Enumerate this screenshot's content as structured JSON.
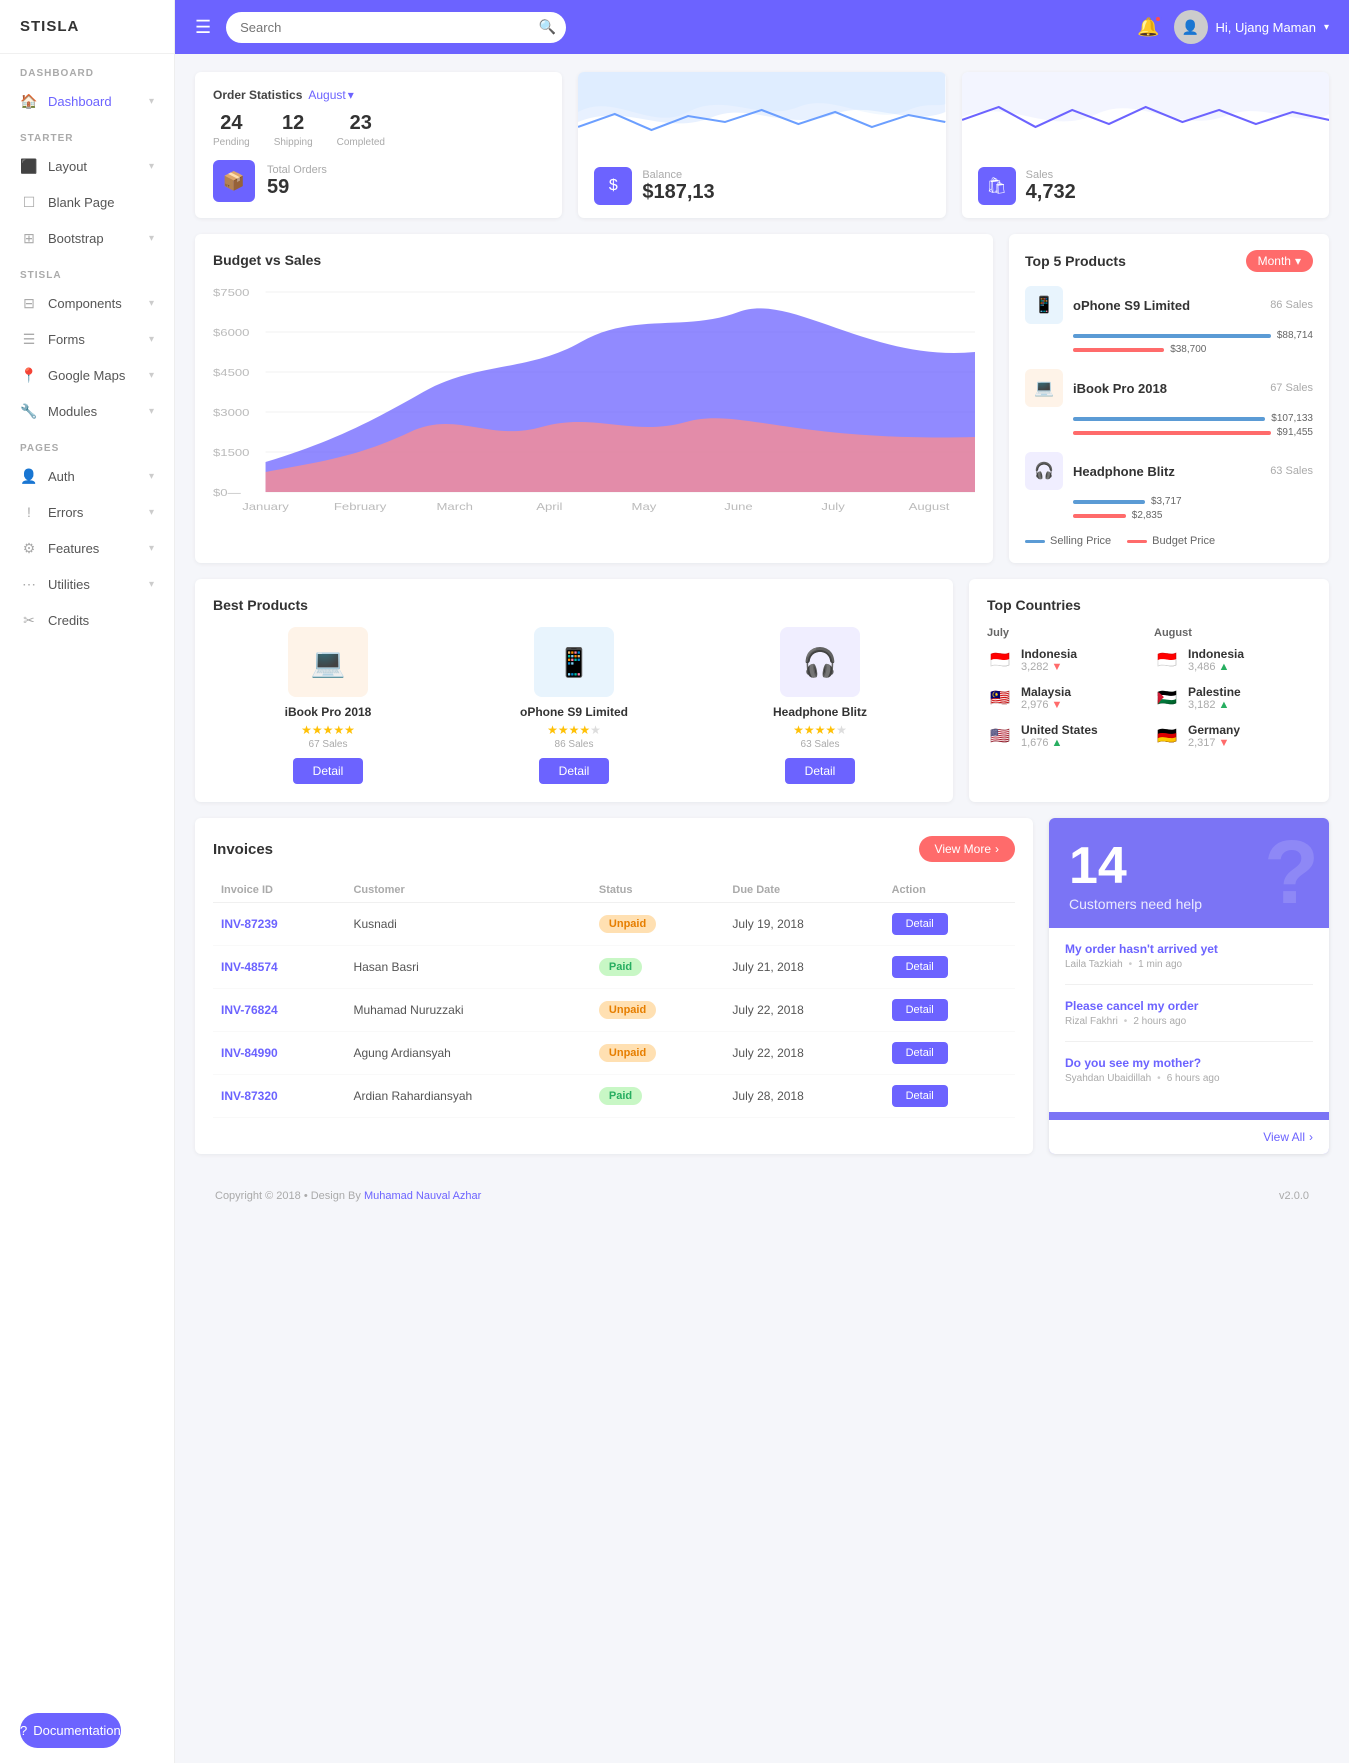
{
  "app": {
    "title": "STISLA"
  },
  "sidebar": {
    "sections": [
      {
        "label": "DASHBOARD",
        "items": [
          {
            "id": "dashboard",
            "label": "Dashboard",
            "icon": "🏠",
            "arrow": true
          }
        ]
      },
      {
        "label": "STARTER",
        "items": [
          {
            "id": "layout",
            "label": "Layout",
            "icon": "⬛",
            "arrow": true
          },
          {
            "id": "blank",
            "label": "Blank Page",
            "icon": "☐",
            "arrow": false
          },
          {
            "id": "bootstrap",
            "label": "Bootstrap",
            "icon": "⊞",
            "arrow": true
          }
        ]
      },
      {
        "label": "STISLA",
        "items": [
          {
            "id": "components",
            "label": "Components",
            "icon": "⊟",
            "arrow": true
          },
          {
            "id": "forms",
            "label": "Forms",
            "icon": "☰",
            "arrow": true
          },
          {
            "id": "googlemaps",
            "label": "Google Maps",
            "icon": "📍",
            "arrow": true
          },
          {
            "id": "modules",
            "label": "Modules",
            "icon": "🔧",
            "arrow": true
          }
        ]
      },
      {
        "label": "PAGES",
        "items": [
          {
            "id": "auth",
            "label": "Auth",
            "icon": "👤",
            "arrow": true
          },
          {
            "id": "errors",
            "label": "Errors",
            "icon": "!",
            "arrow": true
          },
          {
            "id": "features",
            "label": "Features",
            "icon": "⚙",
            "arrow": true
          },
          {
            "id": "utilities",
            "label": "Utilities",
            "icon": "⋯",
            "arrow": true
          },
          {
            "id": "credits",
            "label": "Credits",
            "icon": "✂",
            "arrow": false
          }
        ]
      }
    ],
    "doc_btn": "Documentation"
  },
  "topbar": {
    "search_placeholder": "Search",
    "username": "Hi, Ujang Maman"
  },
  "order_stats": {
    "title": "Order Statistics",
    "month": "August",
    "pending_label": "Pending",
    "pending_val": "24",
    "shipping_label": "Shipping",
    "shipping_val": "12",
    "completed_label": "Completed",
    "completed_val": "23",
    "total_orders_label": "Total Orders",
    "total_orders_val": "59"
  },
  "balance": {
    "label": "Balance",
    "value": "$187,13"
  },
  "sales": {
    "label": "Sales",
    "value": "4,732"
  },
  "budget_chart": {
    "title": "Budget vs Sales",
    "months": [
      "January",
      "February",
      "March",
      "April",
      "May",
      "June",
      "July",
      "August"
    ],
    "y_labels": [
      "$7500",
      "$6000",
      "$4500",
      "$3000",
      "$1500",
      "$0-"
    ]
  },
  "top_products": {
    "title": "Top 5 Products",
    "month_btn": "Month",
    "legend_selling": "Selling Price",
    "legend_budget": "Budget Price",
    "items": [
      {
        "name": "oPhone S9 Limited",
        "icon_type": "blue-light",
        "icon": "📱",
        "sales": "86 Sales",
        "selling_val": "$88,714",
        "selling_pct": 85,
        "budget_val": "$38,700",
        "budget_pct": 38
      },
      {
        "name": "iBook Pro 2018",
        "icon_type": "orange-light",
        "icon": "💻",
        "sales": "67 Sales",
        "selling_val": "$107,133",
        "selling_pct": 100,
        "budget_val": "$91,455",
        "budget_pct": 86
      },
      {
        "name": "Headphone Blitz",
        "icon_type": "purple-light",
        "icon": "🎧",
        "sales": "63 Sales",
        "selling_val": "$3,717",
        "selling_pct": 30,
        "budget_val": "$2,835",
        "budget_pct": 22
      }
    ]
  },
  "best_products": {
    "title": "Best Products",
    "items": [
      {
        "name": "iBook Pro 2018",
        "icon": "💻",
        "icon_type": "orange",
        "stars": 5,
        "sales": "67 Sales"
      },
      {
        "name": "oPhone S9 Limited",
        "icon": "📱",
        "icon_type": "blue",
        "stars": 4,
        "sales": "86 Sales"
      },
      {
        "name": "Headphone Blitz",
        "icon": "🎧",
        "icon_type": "purple",
        "stars": 4,
        "sales": "63 Sales"
      }
    ],
    "detail_btn": "Detail"
  },
  "top_countries": {
    "title": "Top Countries",
    "july_label": "July",
    "august_label": "August",
    "july_items": [
      {
        "country": "Indonesia",
        "flag": "🇮🇩",
        "count": "3,282",
        "trend": "down"
      },
      {
        "country": "Malaysia",
        "flag": "🇲🇾",
        "count": "2,976",
        "trend": "down"
      },
      {
        "country": "United States",
        "flag": "🇺🇸",
        "count": "1,676",
        "trend": "up"
      }
    ],
    "august_items": [
      {
        "country": "Indonesia",
        "flag": "🇮🇩",
        "count": "3,486",
        "trend": "up"
      },
      {
        "country": "Palestine",
        "flag": "🇵🇸",
        "count": "3,182",
        "trend": "up"
      },
      {
        "country": "Germany",
        "flag": "🇩🇪",
        "count": "2,317",
        "trend": "down"
      }
    ]
  },
  "invoices": {
    "title": "Invoices",
    "view_more": "View More",
    "columns": [
      "Invoice ID",
      "Customer",
      "Status",
      "Due Date",
      "Action"
    ],
    "rows": [
      {
        "id": "INV-87239",
        "customer": "Kusnadi",
        "status": "Unpaid",
        "due_date": "July 19, 2018",
        "action": "Detail"
      },
      {
        "id": "INV-48574",
        "customer": "Hasan Basri",
        "status": "Paid",
        "due_date": "July 21, 2018",
        "action": "Detail"
      },
      {
        "id": "INV-76824",
        "customer": "Muhamad Nuruzzaki",
        "status": "Unpaid",
        "due_date": "July 22, 2018",
        "action": "Detail"
      },
      {
        "id": "INV-84990",
        "customer": "Agung Ardiansyah",
        "status": "Unpaid",
        "due_date": "July 22, 2018",
        "action": "Detail"
      },
      {
        "id": "INV-87320",
        "customer": "Ardian Rahardiansyah",
        "status": "Paid",
        "due_date": "July 28, 2018",
        "action": "Detail"
      }
    ]
  },
  "help": {
    "count": "14",
    "label": "Customers need help",
    "messages": [
      {
        "title": "My order hasn't arrived yet",
        "user": "Laila Tazkiah",
        "time": "1 min ago"
      },
      {
        "title": "Please cancel my order",
        "user": "Rizal Fakhri",
        "time": "2 hours ago"
      },
      {
        "title": "Do you see my mother?",
        "user": "Syahdan Ubaidillah",
        "time": "6 hours ago"
      }
    ],
    "view_all": "View All"
  },
  "footer": {
    "copyright": "Copyright © 2018  •  Design By",
    "author": "Muhamad Nauval Azhar",
    "version": "v2.0.0"
  }
}
